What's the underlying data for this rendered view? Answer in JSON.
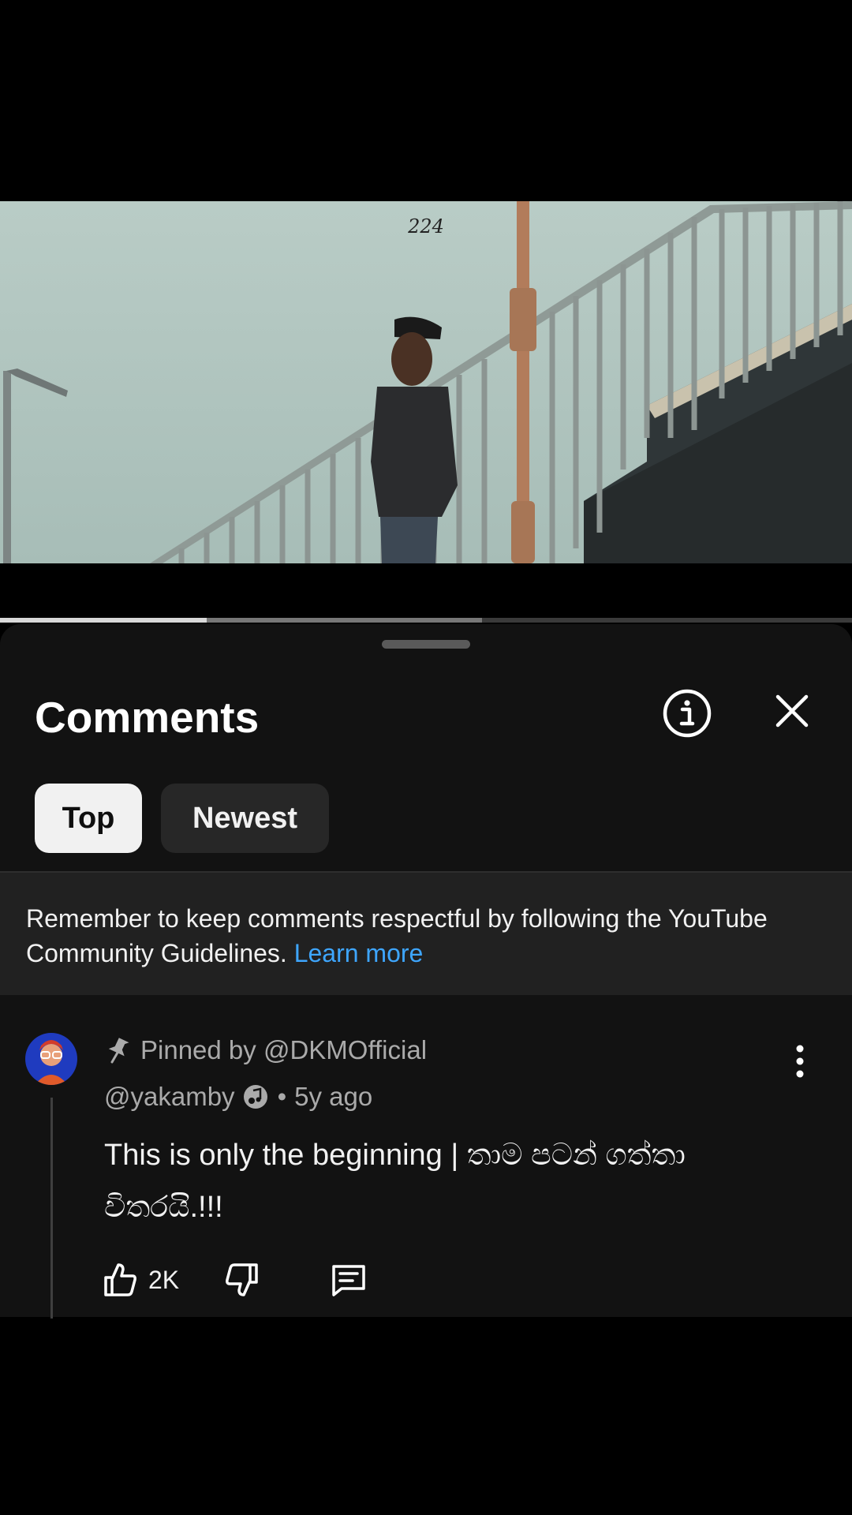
{
  "video": {
    "watermark": "224"
  },
  "progress": {
    "played_fraction": 0.243,
    "buffered_fraction": 0.566
  },
  "comments_sheet": {
    "title": "Comments",
    "info_icon": "info-icon",
    "close_icon": "close-icon",
    "filters": [
      {
        "label": "Top",
        "selected": true
      },
      {
        "label": "Newest",
        "selected": false
      }
    ],
    "guidelines": {
      "text": "Remember to keep comments respectful by following the YouTube Community Guidelines.",
      "link": "Learn more"
    }
  },
  "comment": {
    "pinned_by": "Pinned by @DKMOfficial",
    "author": "@yakamby",
    "separator": "•",
    "age": "5y ago",
    "text": "This is only the beginning | තාම පටන් ගත්තා විතරයි.!!!",
    "like_count": "2K",
    "icons": [
      "pin-icon",
      "music-badge-icon",
      "more-vert-icon",
      "thumbs-up-icon",
      "thumbs-down-icon",
      "reply-icon"
    ]
  },
  "colors": {
    "sheet_bg": "#121212",
    "banner_bg": "#212121",
    "link": "#3ea6ff",
    "secondary_text": "#aaaaaa"
  }
}
